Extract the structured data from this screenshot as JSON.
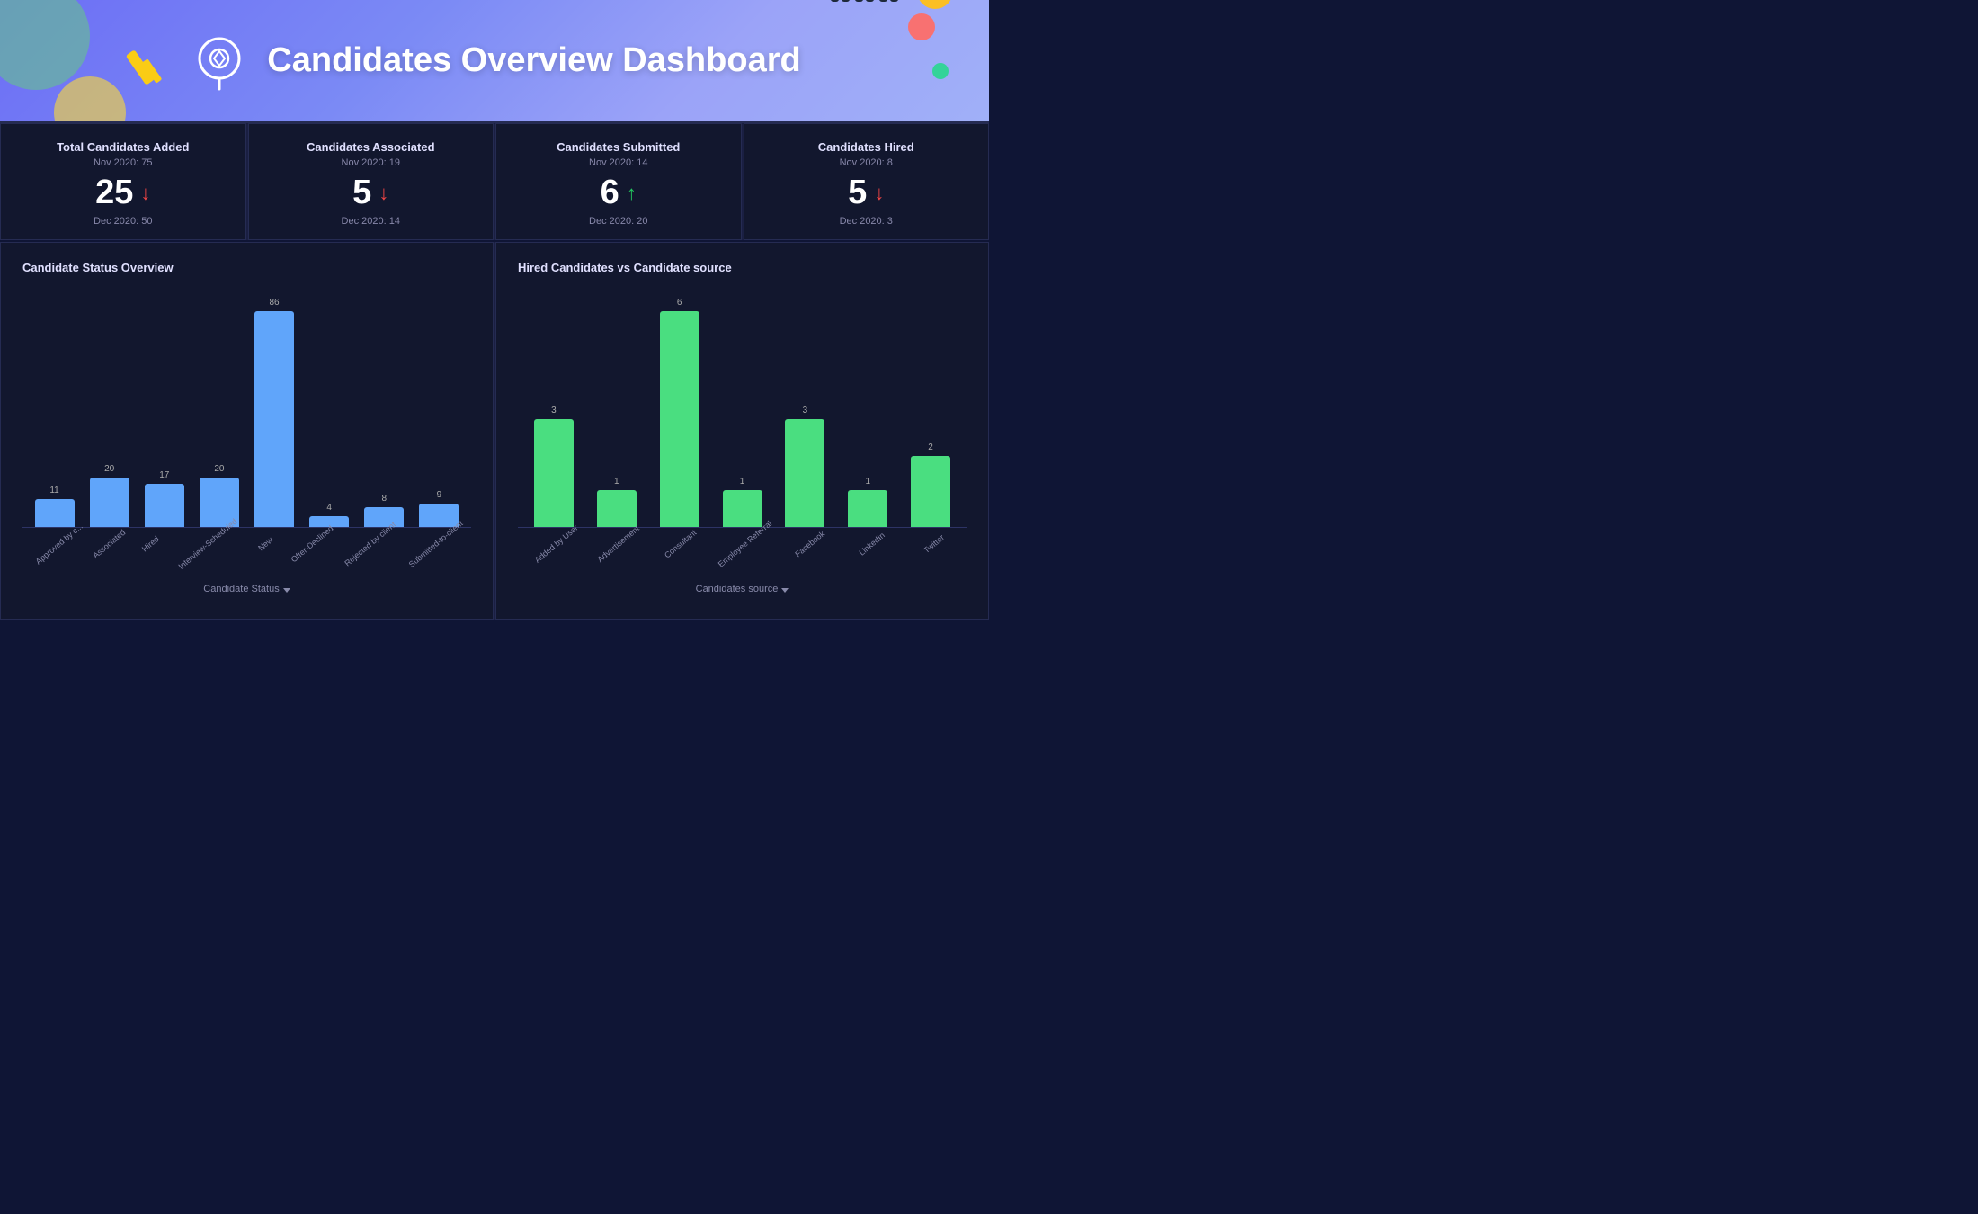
{
  "header": {
    "title": "Candidates Overview Dashboard",
    "icon_label": "candidates-icon"
  },
  "metrics": [
    {
      "title": "Total Candidates Added",
      "prev_label": "Nov 2020: 75",
      "value": "25",
      "arrow": "down",
      "curr_label": "Dec 2020: 50"
    },
    {
      "title": "Candidates Associated",
      "prev_label": "Nov 2020: 19",
      "value": "5",
      "arrow": "down",
      "curr_label": "Dec 2020: 14"
    },
    {
      "title": "Candidates Submitted",
      "prev_label": "Nov 2020: 14",
      "value": "6",
      "arrow": "up",
      "curr_label": "Dec 2020: 20"
    },
    {
      "title": "Candidates Hired",
      "prev_label": "Nov 2020: 8",
      "value": "5",
      "arrow": "down",
      "curr_label": "Dec 2020: 3"
    }
  ],
  "status_chart": {
    "title": "Candidate Status Overview",
    "x_axis_label": "Candidate Status",
    "bars": [
      {
        "label": "Approved by c...",
        "value": 11,
        "height_pct": 13
      },
      {
        "label": "Associated",
        "value": 20,
        "height_pct": 23
      },
      {
        "label": "Hired",
        "value": 17,
        "height_pct": 20
      },
      {
        "label": "Interview-Scheduled",
        "value": 20,
        "height_pct": 23
      },
      {
        "label": "New",
        "value": 86,
        "height_pct": 100
      },
      {
        "label": "Offer-Declined",
        "value": 4,
        "height_pct": 5
      },
      {
        "label": "Rejected by client",
        "value": 8,
        "height_pct": 9
      },
      {
        "label": "Submitted-to-client",
        "value": 9,
        "height_pct": 11
      }
    ]
  },
  "source_chart": {
    "title": "Hired Candidates vs Candidate source",
    "x_axis_label": "Candidates source",
    "bars": [
      {
        "label": "Added by User",
        "value": 3,
        "height_pct": 50
      },
      {
        "label": "Advertisement",
        "value": 1,
        "height_pct": 17
      },
      {
        "label": "Consultant",
        "value": 6,
        "height_pct": 100
      },
      {
        "label": "Employee Referral",
        "value": 1,
        "height_pct": 17
      },
      {
        "label": "Facebook",
        "value": 3,
        "height_pct": 50
      },
      {
        "label": "LinkedIn",
        "value": 1,
        "height_pct": 17
      },
      {
        "label": "Twitter",
        "value": 2,
        "height_pct": 33
      }
    ]
  }
}
